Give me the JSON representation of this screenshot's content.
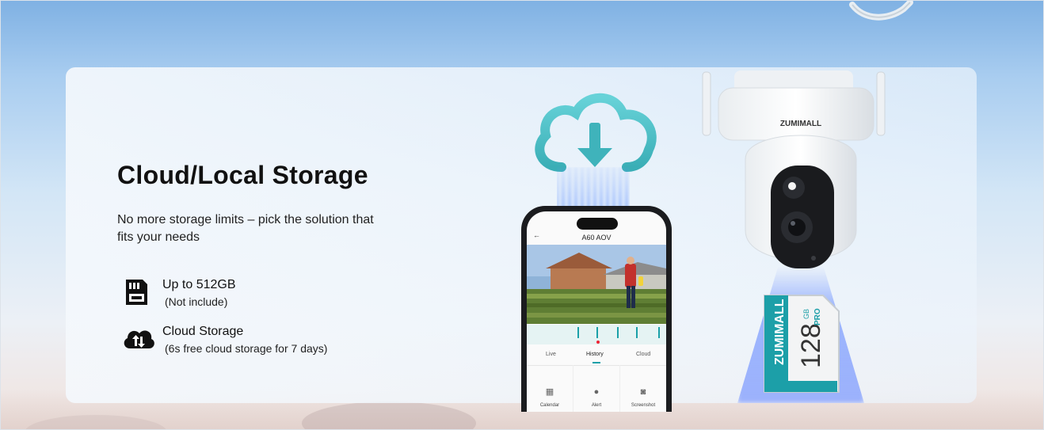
{
  "hero": {
    "title": "Cloud/Local Storage",
    "subtitle": "No more storage limits – pick the solution that fits your needs"
  },
  "features": [
    {
      "icon": "sd-card-icon",
      "title": "Up to 512GB",
      "note": "(Not include)"
    },
    {
      "icon": "cloud-storage-icon",
      "title": "Cloud Storage",
      "note": "(6s free cloud storage for 7 days)"
    }
  ],
  "phone": {
    "back": "←",
    "title": "A60 AOV",
    "tabs": [
      "Live",
      "History",
      "Cloud"
    ],
    "active_tab": "History",
    "tools": [
      {
        "icon": "calendar-icon",
        "label": "Calendar"
      },
      {
        "icon": "alert-icon",
        "label": "Alert"
      },
      {
        "icon": "screenshot-icon",
        "label": "Screenshot"
      }
    ]
  },
  "camera": {
    "brand": "ZUMIMALL"
  },
  "sd_card": {
    "brand": "ZUMIMALL",
    "capacity": "128",
    "unit": "GB",
    "tier": "PRO"
  },
  "colors": {
    "teal": "#1aa0a8",
    "cloud": "#4cc2c9",
    "text": "#111111"
  }
}
